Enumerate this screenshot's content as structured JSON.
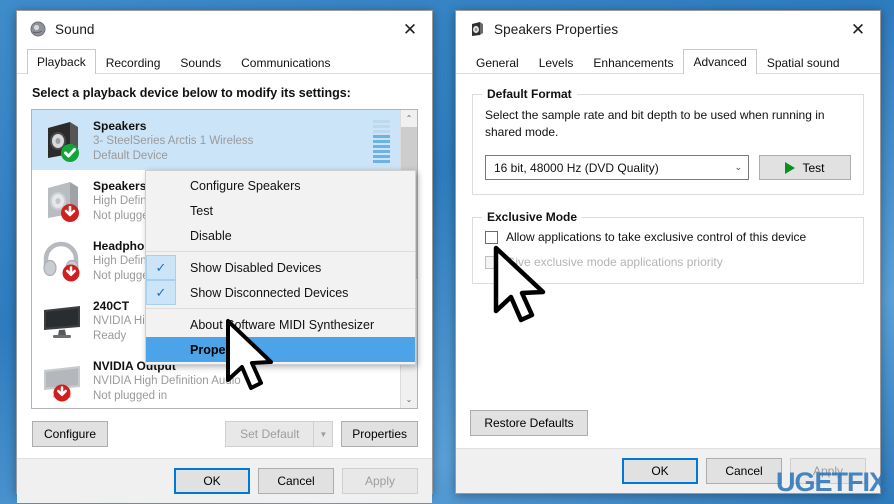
{
  "desktop": {
    "background_color": "#2e7cbe",
    "watermark": "UGETFIX"
  },
  "sound_dialog": {
    "title": "Sound",
    "title_icon": "speaker-icon",
    "close_label": "✕",
    "tabs": [
      {
        "label": "Playback",
        "active": true
      },
      {
        "label": "Recording",
        "active": false
      },
      {
        "label": "Sounds",
        "active": false
      },
      {
        "label": "Communications",
        "active": false
      }
    ],
    "hint": "Select a playback device below to modify its settings:",
    "devices": [
      {
        "name": "Speakers",
        "sub": "3- SteelSeries Arctis 1 Wireless",
        "status": "Default Device",
        "icon": "speaker-box-icon",
        "badge": "check-badge",
        "selected": true,
        "meter": true
      },
      {
        "name": "Speakers",
        "sub": "High Definition Audio Device",
        "status": "Not plugged in",
        "icon": "speaker-box-icon",
        "badge": "down-arrow-badge",
        "selected": false,
        "meter": false
      },
      {
        "name": "Headphones",
        "sub": "High Definition Audio Device",
        "status": "Not plugged in",
        "icon": "headphones-icon",
        "badge": "down-arrow-badge",
        "selected": false,
        "meter": false
      },
      {
        "name": "240CT",
        "sub": "NVIDIA High Definition Audio",
        "status": "Ready",
        "icon": "monitor-icon",
        "badge": "",
        "selected": false,
        "meter": false
      },
      {
        "name": "NVIDIA Output",
        "sub": "NVIDIA High Definition Audio",
        "status": "Not plugged in",
        "icon": "monitor-icon",
        "badge": "down-arrow-badge",
        "selected": false,
        "meter": false
      }
    ],
    "scrollbar": {
      "up_glyph": "⌃",
      "down_glyph": "⌄"
    },
    "list_buttons": {
      "configure": "Configure",
      "set_default": "Set Default",
      "set_default_arrow": "▼",
      "properties": "Properties"
    },
    "footer": {
      "ok": "OK",
      "cancel": "Cancel",
      "apply": "Apply"
    }
  },
  "context_menu": {
    "items": [
      {
        "label": "Configure Speakers",
        "checked": false,
        "highlight": false,
        "separator_after": false
      },
      {
        "label": "Test",
        "checked": false,
        "highlight": false,
        "separator_after": false
      },
      {
        "label": "Disable",
        "checked": false,
        "highlight": false,
        "separator_after": true
      },
      {
        "label": "Show Disabled Devices",
        "checked": true,
        "highlight": false,
        "separator_after": false
      },
      {
        "label": "Show Disconnected Devices",
        "checked": true,
        "highlight": false,
        "separator_after": true
      },
      {
        "label": "About Software MIDI Synthesizer",
        "checked": false,
        "highlight": false,
        "separator_after": false
      },
      {
        "label": "Properties",
        "checked": false,
        "highlight": true,
        "separator_after": false
      }
    ],
    "check_glyph": "✓"
  },
  "properties_dialog": {
    "title": "Speakers Properties",
    "title_icon": "speaker-properties-icon",
    "close_label": "✕",
    "tabs": [
      {
        "label": "General",
        "active": false
      },
      {
        "label": "Levels",
        "active": false
      },
      {
        "label": "Enhancements",
        "active": false
      },
      {
        "label": "Advanced",
        "active": true
      },
      {
        "label": "Spatial sound",
        "active": false
      }
    ],
    "default_format": {
      "legend": "Default Format",
      "description": "Select the sample rate and bit depth to be used when running in shared mode.",
      "selected_value": "16 bit, 48000 Hz (DVD Quality)",
      "dropdown_arrow": "⌄",
      "test_button": "Test"
    },
    "exclusive_mode": {
      "legend": "Exclusive Mode",
      "option1": {
        "label": "Allow applications to take exclusive control of this device",
        "checked": false,
        "enabled": true
      },
      "option2": {
        "label": "Give exclusive mode applications priority",
        "checked": false,
        "enabled": false
      }
    },
    "restore_defaults": "Restore Defaults",
    "footer": {
      "ok": "OK",
      "cancel": "Cancel",
      "apply": "Apply"
    }
  }
}
